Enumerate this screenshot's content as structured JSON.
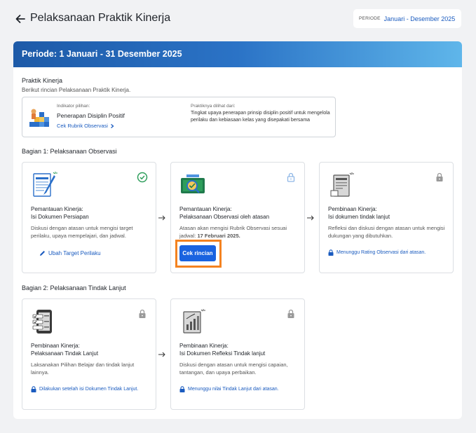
{
  "header": {
    "title": "Pelaksanaan Praktik Kinerja",
    "periode_label": "PERIODE",
    "periode_value": "Januari - Desember 2025"
  },
  "panel": {
    "title": "Periode: 1 Januari - 31 Desember 2025"
  },
  "praktik": {
    "title": "Praktik Kinerja",
    "subtitle": "Berikut rincian Pelaksanaan Praktik Kinerja.",
    "indicator_label": "Indikator pilihan:",
    "indicator_name": "Penerapan Disiplin Positif",
    "rubrik_link": "Cek Rubrik Observasi",
    "seen_label": "Praktiknya dilihat dari:",
    "seen_desc": "Tingkat upaya penerapan prinsip disiplin positif untuk mengelola perilaku dan kebiasaan kelas yang disepakati bersama"
  },
  "bagian1": {
    "title": "Bagian 1: Pelaksanaan Observasi",
    "cards": [
      {
        "title1": "Pemantauan Kinerja:",
        "title2": "Isi Dokumen Persiapan",
        "desc": "Diskusi dengan atasan untuk mengisi target perilaku, upaya mempelajari, dan jadwal.",
        "action": "Ubah Target Perilaku",
        "status_icon": "check-circle-icon"
      },
      {
        "title1": "Pemantauan Kinerja:",
        "title2": "Pelaksanaan Observasi oleh atasan",
        "desc_pre": "Atasan akan mengisi Rubrik Observasi sesuai jadwal: ",
        "desc_date": "17 Februari 2025.",
        "button": "Cek rincian",
        "status_icon": "lock-icon"
      },
      {
        "title1": "Pembinaan Kinerja:",
        "title2": "Isi dokumen tindak lanjut",
        "desc": "Refleksi dan diskusi dengan atasan untuk mengisi dukungan yang dibutuhkan.",
        "wait": "Menunggu Rating Observasi dari atasan.",
        "status_icon": "lock-icon"
      }
    ]
  },
  "bagian2": {
    "title": "Bagian 2: Pelaksanaan Tindak Lanjut",
    "cards": [
      {
        "title1": "Pembinaan Kinerja:",
        "title2": "Pelaksanaan Tindak Lanjut",
        "desc": "Laksanakan Pilihan Belajar dan tindak lanjut lainnya.",
        "wait": "Dilakukan setelah isi Dokumen Tindak Lanjut.",
        "status_icon": "lock-icon"
      },
      {
        "title1": "Pembinaan Kinerja:",
        "title2": "Isi Dokumen Refleksi Tindak lanjut",
        "desc": "Diskusi dengan atasan untuk mengisi capaian, tantangan, dan upaya perbaikan.",
        "wait": "Menunggu nilai Tindak Lanjut dari atasan.",
        "status_icon": "lock-icon"
      }
    ]
  },
  "colors": {
    "brand_blue": "#1a5bbf",
    "button_blue": "#1a63e0",
    "success_green": "#2e9e5b",
    "highlight_orange": "#f48220"
  }
}
